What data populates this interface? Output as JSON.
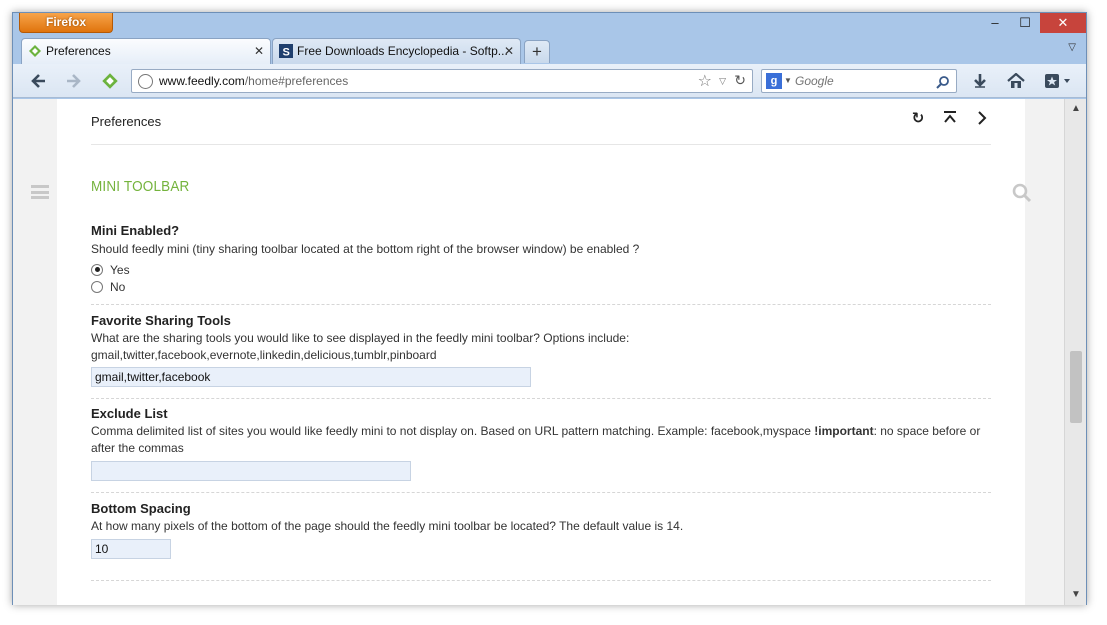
{
  "browser": {
    "app_button": "Firefox",
    "window_controls": {
      "minimize": "–",
      "maximize": "☐",
      "close": "✕"
    }
  },
  "tabs": [
    {
      "label": "Preferences",
      "active": true
    },
    {
      "label": "Free Downloads Encyclopedia - Softp...",
      "active": false
    }
  ],
  "new_tab_label": "+",
  "url": {
    "host": "www.feedly.com",
    "path": "/home#preferences"
  },
  "search": {
    "engine_letter": "g",
    "placeholder": "Google"
  },
  "page": {
    "header_title": "Preferences",
    "section_title": "MINI TOOLBAR",
    "colors": {
      "accent": "#74b33c"
    },
    "prefs": {
      "mini_enabled": {
        "heading": "Mini Enabled?",
        "description": "Should feedly mini (tiny sharing toolbar located at the bottom right of the browser window) be enabled ?",
        "options": [
          {
            "label": "Yes",
            "checked": true
          },
          {
            "label": "No",
            "checked": false
          }
        ]
      },
      "sharing_tools": {
        "heading": "Favorite Sharing Tools",
        "description": "What are the sharing tools you would like to see displayed in the feedly mini toolbar? Options include:",
        "options_text": "gmail,twitter,facebook,evernote,linkedin,delicious,tumblr,pinboard",
        "value": "gmail,twitter,facebook"
      },
      "exclude_list": {
        "heading": "Exclude List",
        "description_before": "Comma delimited list of sites you would like feedly mini to not display on. Based on URL pattern matching. Example: facebook,myspace ",
        "description_bold": "!important",
        "description_after": ": no space before or after the commas",
        "value": ""
      },
      "bottom_spacing": {
        "heading": "Bottom Spacing",
        "description": "At how many pixels of the bottom of the page should the feedly mini toolbar be located? The default value is 14.",
        "value": "10"
      }
    }
  }
}
